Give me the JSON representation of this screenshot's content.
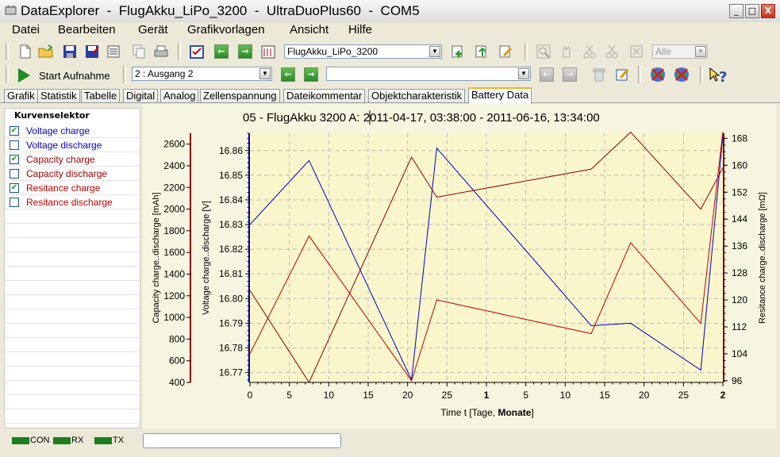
{
  "window": {
    "title": "DataExplorer  -  FlugAkku_LiPo_3200  -  UltraDuoPlus60  -  COM5",
    "minimize": "_",
    "maximize": "□",
    "close": "X"
  },
  "menu": [
    "Datei",
    "Bearbeiten",
    "Gerät",
    "Grafikvorlagen",
    "Ansicht",
    "Hilfe"
  ],
  "toolbar1": {
    "channel_combo": "FlugAkku_LiPo_3200",
    "filter_combo": "Alle"
  },
  "toolbar2": {
    "start_label": "Start Aufnahme",
    "output_combo": "2 : Ausgang 2",
    "record_combo": ""
  },
  "tabs": [
    "Grafik",
    "Statistik",
    "Tabelle",
    "Digital",
    "Analog",
    "Zellenspannung",
    "Dateikommentar",
    "Objektcharakteristik",
    "Battery Data"
  ],
  "active_tab": "Battery Data",
  "selector": {
    "title": "Kurvenselektor",
    "items": [
      {
        "label": "Voltage charge",
        "checked": true,
        "color": "#0000c0"
      },
      {
        "label": "Voltage discharge",
        "checked": false,
        "color": "#0000c0"
      },
      {
        "label": "Capacity charge",
        "checked": true,
        "color": "#a00000"
      },
      {
        "label": "Capacity discharge",
        "checked": false,
        "color": "#a00000"
      },
      {
        "label": "Resitance charge",
        "checked": true,
        "color": "#a00000"
      },
      {
        "label": "Resitance discharge",
        "checked": false,
        "color": "#a00000"
      }
    ]
  },
  "chart_data": {
    "type": "line",
    "title": "05 - FlugAkku 3200 A: 2011-04-17, 03:38:00 - 2011-06-16, 13:34:00",
    "xlabel": "Time   t   [Tage, Monate]",
    "xlabel_plain": "Time   t   [Tage, ",
    "xlabel_bold": "Monate",
    "xlabel_end": "]",
    "x_ticks": [
      "0",
      "5",
      "10",
      "15",
      "20",
      "25",
      "1",
      "5",
      "10",
      "15",
      "20",
      "25",
      "2"
    ],
    "x_bold_ticks": [
      "1",
      "2"
    ],
    "xlim": [
      0,
      60
    ],
    "left_axis_capacity": {
      "label": "Capacity charge..discharge  [mAh]",
      "ticks": [
        "400",
        "600",
        "800",
        "1000",
        "1200",
        "1400",
        "1600",
        "1800",
        "2000",
        "2200",
        "2400",
        "2600"
      ],
      "ylim": [
        400,
        2700
      ]
    },
    "left_axis_voltage": {
      "label": "Voltage charge..discharge  [V]",
      "ticks": [
        "16.77",
        "16.78",
        "16.79",
        "16.80",
        "16.81",
        "16.82",
        "16.83",
        "16.84",
        "16.85",
        "16.86"
      ],
      "ylim": [
        16.766,
        16.867
      ]
    },
    "right_axis_resistance": {
      "label": "Resitance charge..discharge  [mΩ]",
      "ticks": [
        "96",
        "104",
        "112",
        "120",
        "128",
        "136",
        "144",
        "152",
        "160",
        "168"
      ],
      "ylim": [
        95.5,
        169.5
      ]
    },
    "series": [
      {
        "name": "Voltage charge",
        "color": "#0000c0",
        "axis": "voltage",
        "x": [
          0,
          7.5,
          20.5,
          23.7,
          43.3,
          48.3,
          57.2,
          60
        ],
        "y": [
          16.83,
          16.856,
          16.767,
          16.861,
          16.789,
          16.79,
          16.771,
          16.866
        ]
      },
      {
        "name": "Capacity charge",
        "color": "#8b0000",
        "axis": "capacity",
        "x": [
          0,
          7.5,
          20.5,
          23.7,
          43.3,
          48.3,
          57.2,
          60
        ],
        "y": [
          1250,
          400,
          2480,
          2110,
          2370,
          2710,
          2000,
          2380
        ]
      },
      {
        "name": "Resitance charge",
        "color": "#c00000",
        "axis": "resistance",
        "x": [
          0,
          7.5,
          20.5,
          23.7,
          43.3,
          48.3,
          57.2,
          60
        ],
        "y": [
          104,
          139,
          96,
          120,
          110,
          137,
          113,
          170
        ]
      }
    ],
    "grid": true
  },
  "status": {
    "con": "CON",
    "rx": "RX",
    "tx": "TX",
    "message": ""
  }
}
